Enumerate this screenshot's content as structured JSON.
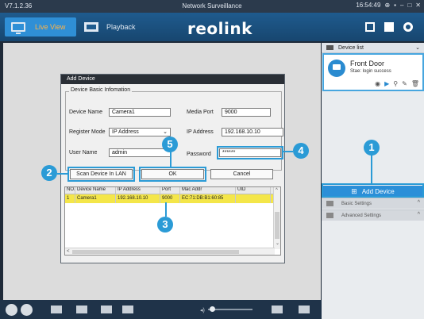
{
  "titlebar": {
    "version": "V7.1.2.36",
    "title": "Network Surveillance",
    "time": "16:54:49"
  },
  "toolbar": {
    "live_view_label": "Live View",
    "playback_label": "Playback",
    "logo_text": "reolink"
  },
  "dialog": {
    "title": "Add Device",
    "legend": "Device Basic Infomation",
    "device_name_label": "Device Name",
    "device_name_value": "Camera1",
    "media_port_label": "Media Port",
    "media_port_value": "9000",
    "register_mode_label": "Register Mode",
    "register_mode_value": "IP Address",
    "ip_address_label": "IP Address",
    "ip_address_value": "192.168.10.10",
    "user_name_label": "User Name",
    "user_name_value": "admin",
    "password_label": "Password",
    "password_value": "******",
    "scan_button": "Scan Device In LAN",
    "ok_button": "OK",
    "cancel_button": "Cancel",
    "table": {
      "headers": [
        "NO.",
        "Device Name",
        "IP Address",
        "Port",
        "Mac Addr",
        "UID"
      ],
      "rows": [
        [
          "1",
          "Camera1",
          "192.168.10.10",
          "9000",
          "EC:71:DB:B1:60:85",
          ""
        ]
      ]
    }
  },
  "right_panel": {
    "device_list_label": "Device list",
    "device": {
      "name": "Front Door",
      "status": "Stae: login success"
    },
    "add_device_label": "Add Device",
    "basic_settings_label": "Basic Settings",
    "advanced_settings_label": "Advanced Settings"
  },
  "callouts": {
    "c1": "1",
    "c2": "2",
    "c3": "3",
    "c4": "4",
    "c5": "5"
  },
  "colors": {
    "accent": "#2b9bd6",
    "selected_row": "#f4e649",
    "toolbar": "#1f5b8e"
  }
}
